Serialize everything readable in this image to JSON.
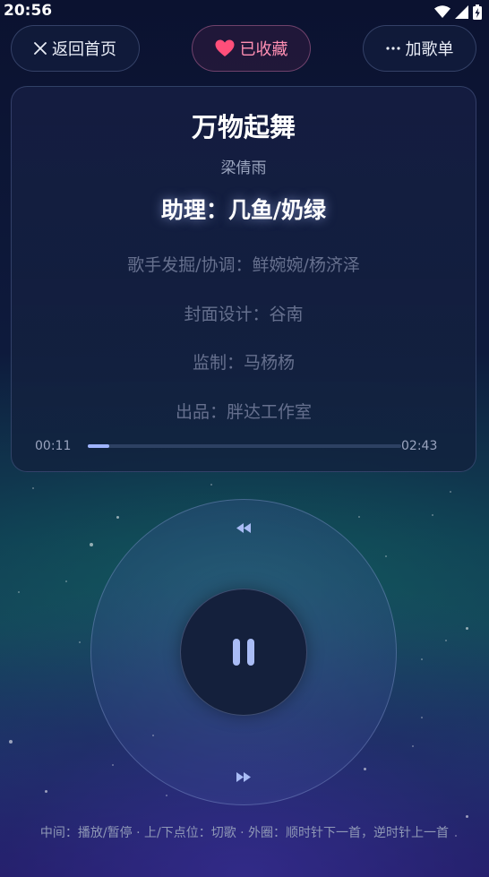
{
  "status_bar": {
    "time": "20:56"
  },
  "top_bar": {
    "home_label": "返回首页",
    "favorite_label": "已收藏",
    "add_playlist_label": "加歌单"
  },
  "song": {
    "title": "万物起舞",
    "artist": "梁倩雨",
    "credit_main": "助理：几鱼/奶绿",
    "credits": [
      "歌手发掘/协调：鲜婉婉/杨济泽",
      "封面设计：谷南",
      "监制：马杨杨",
      "出品：胖达工作室"
    ]
  },
  "progress": {
    "current": "00:11",
    "total": "02:43",
    "fraction": 0.068
  },
  "hint": "中间：播放/暂停 · 上/下点位：切歌 · 外圈：顺时针下一首，逆时针上一首",
  "colors": {
    "accent": "#9fb4ff",
    "favorite": "#ff4f7a"
  },
  "icons": {
    "home": "close-icon",
    "favorite": "heart-icon",
    "add": "more-dots-icon",
    "center": "pause-icon",
    "prev": "rewind-icon",
    "next": "fast-forward-icon"
  }
}
